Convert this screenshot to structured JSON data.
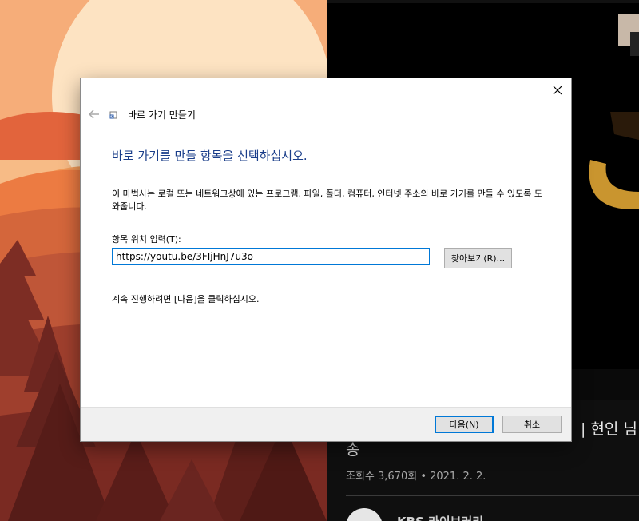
{
  "dialog": {
    "title": "바로 가기 만들기",
    "heading": "바로 가기를 만들 항목을 선택하십시오.",
    "description": "이 마법사는 로컬 또는 네트워크상에 있는 프로그램, 파일, 폴더, 컴퓨터, 인터넷 주소의 바로 가기를 만들 수 있도록 도와줍니다.",
    "location_label": "항목 위치 입력(T):",
    "location_value": "https://youtu.be/3FIjHnJ7u3o",
    "browse_label": "찾아보기(R)...",
    "instruction": "계속 진행하려면 [다음]을 클릭하십시오.",
    "next_label": "다음(N)",
    "cancel_label": "취소",
    "close_icon": "close-icon",
    "back_icon": "back-arrow-icon",
    "accent_color": "#0078d7",
    "heading_color": "#1a3e8a"
  },
  "background_page": {
    "title_tail": "| 현인 님",
    "title_line2": "송",
    "meta": "조회수 3,670회 • 2021. 2. 2.",
    "channel_name": "KBS 라이브러리"
  }
}
